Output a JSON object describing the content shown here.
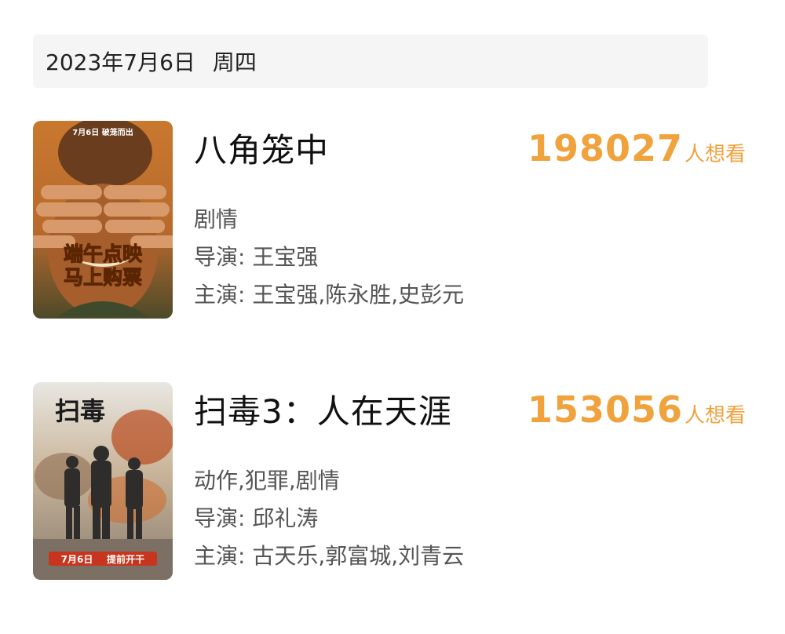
{
  "header": {
    "date": "2023年7月6日",
    "weekday": "周四"
  },
  "movies": [
    {
      "title": "八角笼中",
      "want_count": "198027",
      "want_suffix": "人想看",
      "genre": "剧情",
      "director_label": "导演: ",
      "director": "王宝强",
      "cast_label": "主演: ",
      "cast": "王宝强,陈永胜,史彭元",
      "poster": {
        "top_text": "7月6日 破笼而出",
        "caption_line1": "端午点映",
        "caption_line2": "马上购票"
      }
    },
    {
      "title": "扫毒3：人在天涯",
      "want_count": "153056",
      "want_suffix": "人想看",
      "genre": "动作,犯罪,剧情",
      "director_label": "导演: ",
      "director": "邱礼涛",
      "cast_label": "主演: ",
      "cast": "古天乐,郭富城,刘青云",
      "poster": {
        "logo_text": "扫毒",
        "bottom_date": "7月6日",
        "bottom_text": "提前开干"
      }
    }
  ],
  "colors": {
    "accent": "#f0a23c",
    "date_bar_bg": "#f5f5f5",
    "title_text": "#111111",
    "info_text": "#555555"
  }
}
